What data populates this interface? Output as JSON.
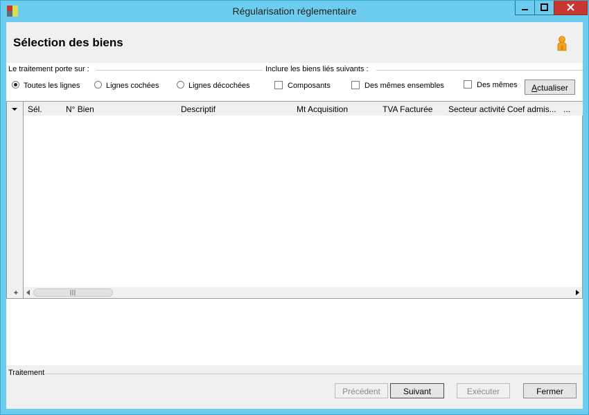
{
  "window": {
    "title": "Régularisation réglementaire",
    "controls": [
      "minimize-icon",
      "maximize-icon",
      "close-icon"
    ]
  },
  "header": {
    "title": "Sélection des biens",
    "icon": "user-icon"
  },
  "scope": {
    "label": "Le traitement porte sur :",
    "options": [
      {
        "label": "Toutes les lignes",
        "selected": true
      },
      {
        "label": "Lignes cochées",
        "selected": false
      },
      {
        "label": "Lignes décochées",
        "selected": false
      }
    ]
  },
  "linked": {
    "label": "Inclure les biens liés suivants :",
    "options": [
      {
        "label": "Composants",
        "checked": false
      },
      {
        "label": "Des mêmes ensembles",
        "checked": false
      },
      {
        "label": "Des mêmes l",
        "checked": false
      }
    ],
    "refresh_label": "Actualiser"
  },
  "grid": {
    "columns": [
      "Sél.",
      "N° Bien",
      "Descriptif",
      "Mt Acquisition",
      "TVA Facturée",
      "Secteur activité",
      "Coef admis...",
      "..."
    ],
    "rows": [],
    "add_symbol": "+"
  },
  "footer": {
    "label": "Traitement",
    "buttons": [
      {
        "label": "Précédent",
        "enabled": false
      },
      {
        "label": "Suivant",
        "enabled": true
      },
      {
        "label": "Exécuter",
        "enabled": false
      },
      {
        "label": "Fermer",
        "enabled": true
      }
    ]
  },
  "colors": {
    "titlebar": "#6dcdee",
    "close_button": "#c7372f",
    "panel": "#f0f0f0"
  }
}
